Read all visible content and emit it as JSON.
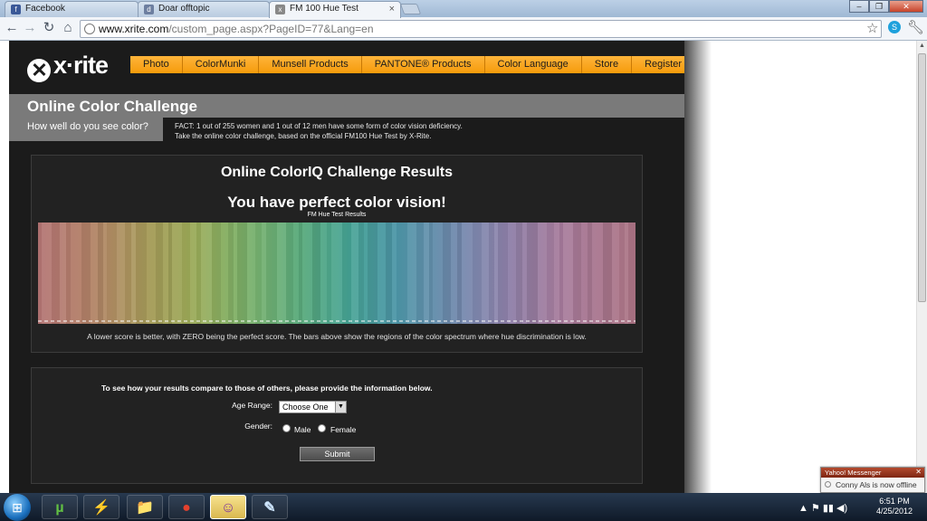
{
  "browser": {
    "tabs": [
      {
        "label": "Facebook",
        "icon": "f",
        "icon_color": "#3b5998"
      },
      {
        "label": "Doar offtopic",
        "icon": "d",
        "icon_color": "#6d7fa0"
      },
      {
        "label": "FM 100 Hue Test",
        "icon": "x",
        "icon_color": "#888888"
      }
    ],
    "url_domain": "www.xrite.com",
    "url_path": "/custom_page.aspx?PageID=77&Lang=en",
    "window_buttons": {
      "minimize": "–",
      "maximize": "❐",
      "close": "✕"
    }
  },
  "site": {
    "logo_text": "x·rite",
    "menu": [
      "Photo",
      "ColorMunki",
      "Munsell Products",
      "PANTONE® Products",
      "Color Language",
      "Store",
      "Register"
    ],
    "page_title": "Online Color Challenge",
    "subtitle": "How well do you see color?",
    "fact_line1": "FACT: 1 out of 255 women and 1 out of 12 men have some form of color vision deficiency.",
    "fact_line2": "Take the online color challenge, based on the official FM100 Hue Test by X-Rite.",
    "results": {
      "heading": "Online ColorIQ Challenge Results",
      "verdict": "You have perfect color vision!",
      "chart_label": "FM Hue Test Results",
      "note": "A lower score is better, with ZERO being the perfect score. The bars above show the regions of the color spectrum where hue discrimination is low."
    },
    "form": {
      "heading": "To see how your results compare to those of others, please provide the information below.",
      "age_label": "Age Range:",
      "age_value": "Choose One",
      "gender_label": "Gender:",
      "gender_options": [
        "Male",
        "Female"
      ],
      "submit_label": "Submit"
    }
  },
  "taskbar": {
    "apps": [
      "µ",
      "⚡",
      "📁",
      "●",
      "☺",
      "✎"
    ],
    "tray_icons": "▲ ⚑ ▮▮ ◀)",
    "time": "6:51 PM",
    "date": "4/25/2012"
  },
  "notification": {
    "title": "Yahoo! Messenger",
    "message": "Conny Als is now offline",
    "close": "✕"
  }
}
